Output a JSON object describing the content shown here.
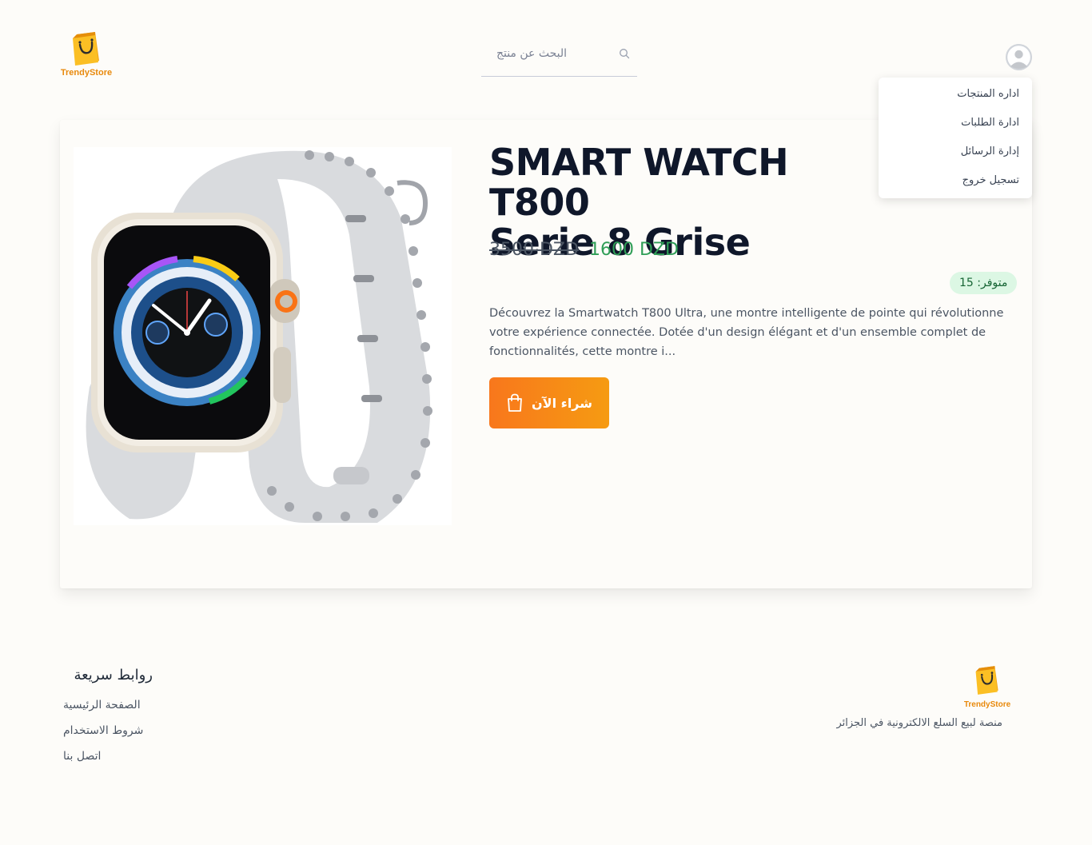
{
  "header": {
    "brand": "TrendyStore",
    "search_placeholder": "البحث عن منتج"
  },
  "user_menu": {
    "items": [
      {
        "label": "اداره المنتجات"
      },
      {
        "label": "ادارة الطلبات"
      },
      {
        "label": "إدارة الرسائل"
      },
      {
        "label": "تسجيل خروج"
      }
    ]
  },
  "product": {
    "title_line1": "SMART WATCH T800",
    "title_line2": "Serie 8 Grise",
    "old_price": "3500 DZD",
    "new_price": "1600 DZD",
    "stock_label": "متوفر: 15",
    "description": "Découvrez la Smartwatch T800 Ultra, une montre intelligente de pointe qui révolutionne votre expérience connectée. Dotée d'un design élégant et d'un ensemble complet de fonctionnalités, cette montre i...",
    "buy_label": "شراء الآن"
  },
  "footer": {
    "quick_links_title": "روابط سريعة",
    "links": [
      {
        "label": "الصفحة الرئيسية"
      },
      {
        "label": "شروط الاستخدام"
      },
      {
        "label": "اتصل بنا"
      }
    ],
    "brand": "TrendyStore",
    "tagline": "منصة لبيع السلع الالكترونية في الجزائر"
  },
  "colors": {
    "accent": "#f7871a",
    "price_green": "#2f9e57",
    "badge_bg": "#dcf7e4"
  }
}
